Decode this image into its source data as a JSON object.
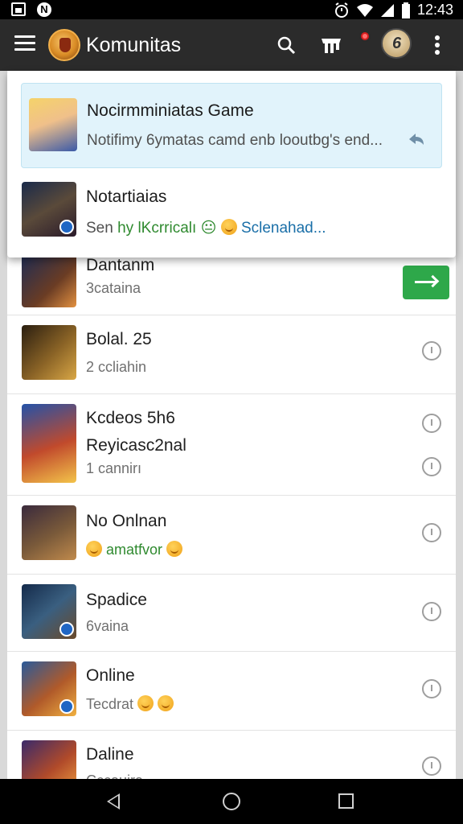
{
  "status_bar": {
    "time": "12:43",
    "icons": [
      "gallery-icon",
      "n-icon",
      "alarm-icon",
      "wifi-icon",
      "signal-icon",
      "battery-icon"
    ]
  },
  "toolbar": {
    "title": "Komunitas",
    "icons": [
      "menu-icon",
      "app-logo-icon",
      "search-icon",
      "store-icon",
      "notification-dot-icon",
      "avatar-icon",
      "overflow-icon"
    ]
  },
  "notifications": [
    {
      "title": "Nocirmminiatas Game",
      "text": "Notifimy 6ymatas camd enb looutbg's end...",
      "highlighted": true
    },
    {
      "title": "Notartiaias",
      "text_prefix": "Sen",
      "text_green": "hy lKcrricalı",
      "text_symbol": "😐",
      "text_blue": "Sclenahad..."
    }
  ],
  "list": [
    {
      "title": "Dantanm",
      "subtitle": "3cataina",
      "action": "join"
    },
    {
      "title": "Bolal. 25",
      "subtitle": "2 ccliahin"
    },
    {
      "title": "Kcdeos 5h6",
      "subtitle": "Reyicasc2nal",
      "subtitle2": "1 cannirı"
    },
    {
      "title": "No Onlnan",
      "subtitle": "amatfvor",
      "subtitle_green": true
    },
    {
      "title": "Spadice",
      "subtitle": "6vaina"
    },
    {
      "title": "Online",
      "subtitle": "Tecdrat"
    },
    {
      "title": "Daline",
      "subtitle": "Cccauira"
    }
  ],
  "colors": {
    "toolbar": "#2b2b2b",
    "accent_green": "#2ea84a",
    "highlight": "#e1f3fb",
    "link_blue": "#1a6fa8"
  }
}
